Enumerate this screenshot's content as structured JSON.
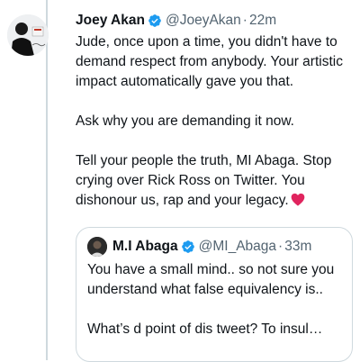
{
  "tweet": {
    "author_name": "Joey Akan",
    "handle": "@JoeyAkan",
    "separator": "·",
    "time": "22m",
    "paragraphs": [
      "Jude, once upon a time, you didn't have to demand respect from anybody. Your artistic impact automatically gave you that.",
      "Ask why you are demanding it now.",
      "Tell your people the truth, MI Abaga. Stop crying over Rick Ross on Twitter. You dishonour us, rap and your legacy."
    ],
    "emoji": "red-heart"
  },
  "quoted_tweet": {
    "author_name": "M.I Abaga",
    "handle": "@MI_Abaga",
    "separator": "·",
    "time": "33m",
    "line1": "You have a small mind.. so not sure you understand what false equivalency is..",
    "line2": "What’s d point of dis tweet? To insul…"
  },
  "colors": {
    "verified": "#1d9bf0",
    "secondary_text": "#536471",
    "heart": "#e0245e",
    "border": "#cfd9de"
  }
}
